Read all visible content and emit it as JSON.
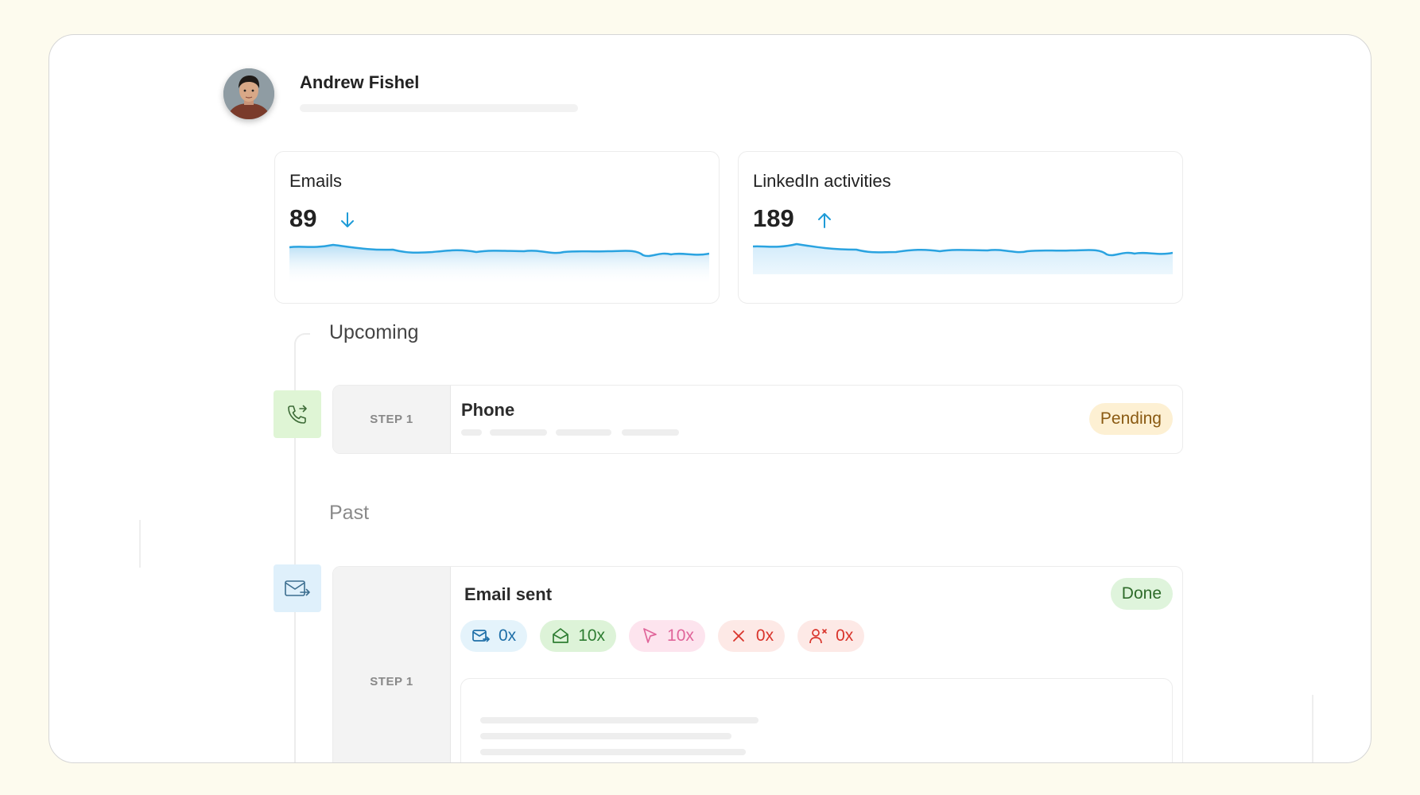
{
  "profile": {
    "name": "Andrew Fishel"
  },
  "stats": [
    {
      "label": "Emails",
      "value": "89",
      "trend": "down",
      "trend_color": "#1e9bd7"
    },
    {
      "label": "LinkedIn activities",
      "value": "189",
      "trend": "up",
      "trend_color": "#1e9bd7"
    }
  ],
  "sections": {
    "upcoming": "Upcoming",
    "past": "Past"
  },
  "upcoming_step": {
    "step_label": "STEP 1",
    "title": "Phone",
    "status": "Pending",
    "icon": "phone-forward-icon"
  },
  "past_step": {
    "step_label": "STEP 1",
    "title": "Email sent",
    "status": "Done",
    "icon": "email-forward-icon",
    "metrics": [
      {
        "icon": "email-sent-icon",
        "value": "0x",
        "color": "#1e6fa8",
        "bg": "#e4f3fb"
      },
      {
        "icon": "email-opened-icon",
        "value": "10x",
        "color": "#2e7d32",
        "bg": "#ddf3d8"
      },
      {
        "icon": "cursor-click-icon",
        "value": "10x",
        "color": "#e0659a",
        "bg": "#fde4ee"
      },
      {
        "icon": "close-icon",
        "value": "0x",
        "color": "#d9342b",
        "bg": "#fde9e6"
      },
      {
        "icon": "user-unsubscribe-icon",
        "value": "0x",
        "color": "#d9342b",
        "bg": "#fde9e6"
      }
    ]
  },
  "colors": {
    "accent": "#1e9bd7",
    "pending_bg": "#fdf0d3",
    "pending_text": "#8a5a12",
    "done_bg": "#dff4dc",
    "done_text": "#2e6b2a",
    "phone_icon_bg": "#dff5d5",
    "email_icon_bg": "#dff0fb"
  }
}
